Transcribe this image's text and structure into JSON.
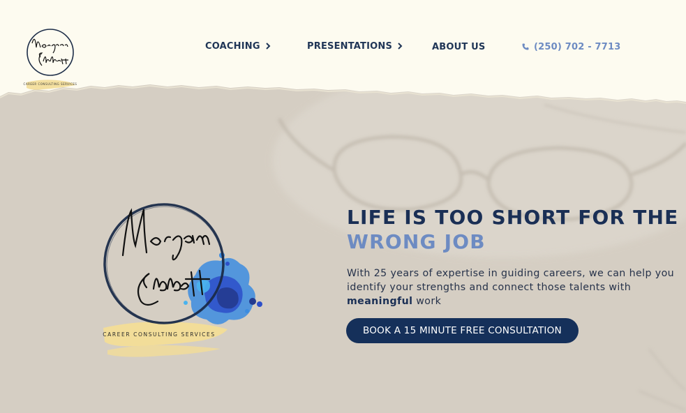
{
  "header": {
    "logo_name": "Morgan Ebbett",
    "logo_tagline": "CAREER CONSULTING SERVICES",
    "nav": [
      {
        "label": "COACHING",
        "icon": "chevron-right-icon"
      },
      {
        "label": "PRESENTATIONS",
        "icon": "chevron-right-icon"
      },
      {
        "label": "ABOUT US"
      }
    ],
    "phone": {
      "label": "(250) 702 - 7713",
      "icon": "phone-icon"
    }
  },
  "hero": {
    "headline_line1": "LIFE IS TOO SHORT FOR THE",
    "headline_line2": "WRONG JOB",
    "body_before": "With 25 years of expertise in guiding careers, we can help you identify your strengths and connect those talents with ",
    "body_bold": "meaningful",
    "body_after": " work",
    "cta_label": "BOOK A 15 MINUTE FREE CONSULTATION",
    "logo_name": "Morgan Ebbett",
    "logo_tagline": "CAREER CONSULTING SERVICES"
  },
  "colors": {
    "header_bg": "#fdfbf0",
    "hero_bg": "#d5cec3",
    "navy": "#1a2f55",
    "accent_blue": "#6d8bc2",
    "button_bg": "#15305a",
    "brush_yellow": "#f3dd97"
  }
}
